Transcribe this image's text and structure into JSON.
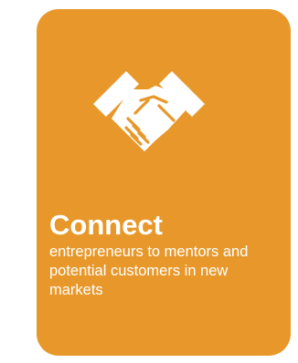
{
  "card": {
    "background_color": "#e8982b",
    "icon": "handshake-icon",
    "title": "Connect",
    "description": "entrepreneurs to mentors and potential customers in new markets"
  }
}
